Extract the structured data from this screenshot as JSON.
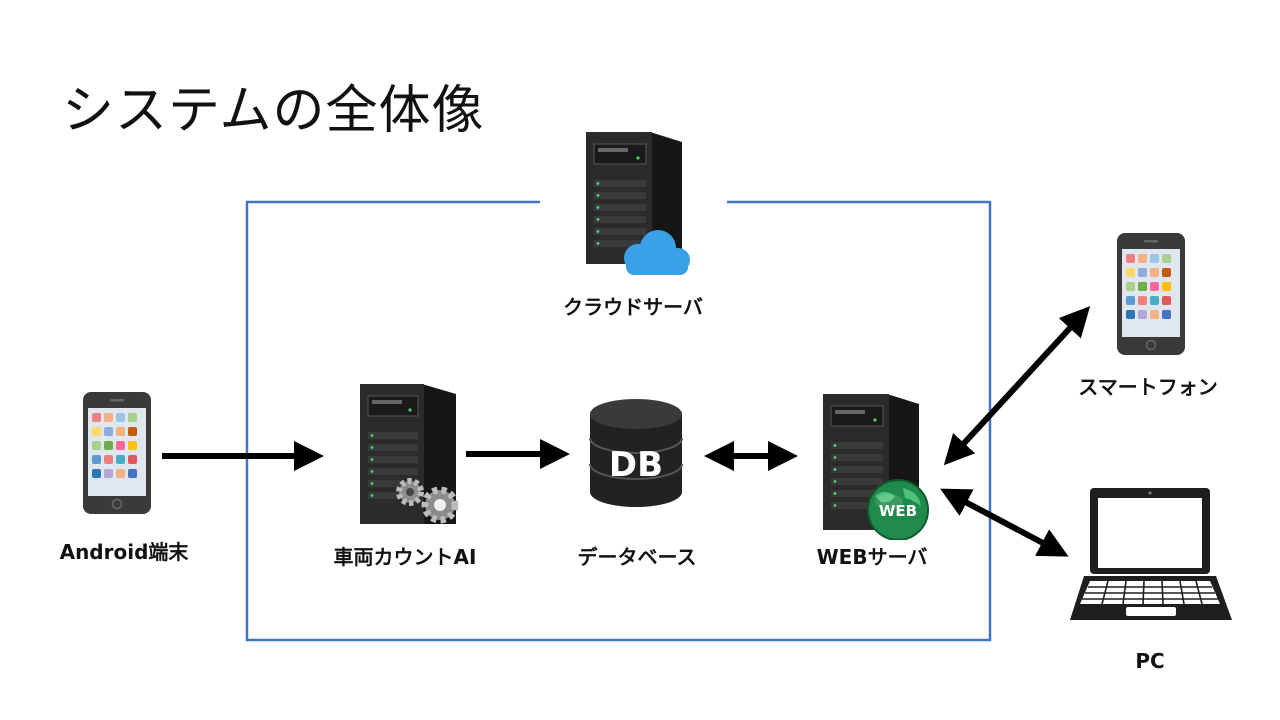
{
  "title": "システムの全体像",
  "colors": {
    "frame": "#4472c4",
    "arrow": "#000000",
    "server_body": "#2b2b2b",
    "server_dark": "#161616",
    "cloud": "#3aa0e8",
    "web_globe": "#1f8a4c"
  },
  "nodes": {
    "android": {
      "label": "Android端末",
      "icon": "smartphone-icon"
    },
    "vehicle_ai": {
      "label": "車両カウントAI",
      "icon": "server-gear-icon"
    },
    "cloud_server": {
      "label": "クラウドサーバ",
      "icon": "server-cloud-icon"
    },
    "database": {
      "label": "データベース",
      "icon": "database-icon",
      "icon_text": "DB"
    },
    "web_server": {
      "label": "WEBサーバ",
      "icon": "server-web-icon",
      "icon_text": "WEB"
    },
    "smartphone": {
      "label": "スマートフォン",
      "icon": "smartphone-icon"
    },
    "pc": {
      "label": "PC",
      "icon": "laptop-icon"
    }
  }
}
